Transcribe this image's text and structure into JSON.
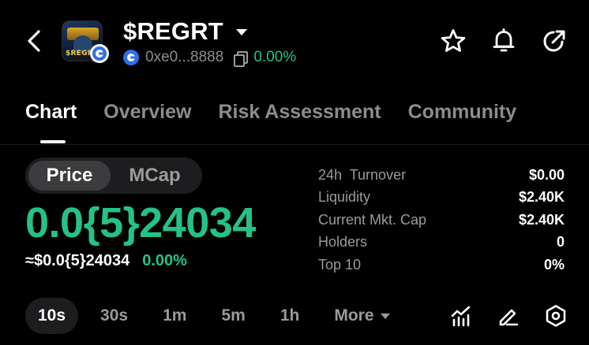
{
  "header": {
    "token_name": "$REGRT",
    "avatar_text": "$REGRT",
    "address": "0xe0...8888",
    "change": "0.00%"
  },
  "tabs": [
    {
      "label": "Chart",
      "active": true
    },
    {
      "label": "Overview",
      "active": false
    },
    {
      "label": "Risk Assessment",
      "active": false
    },
    {
      "label": "Community",
      "active": false
    }
  ],
  "toggle": {
    "price": "Price",
    "mcap": "MCap",
    "selected": "Price"
  },
  "price": {
    "big": "0.0{5}24034",
    "usd": "≈$0.0{5}24034",
    "change": "0.00%"
  },
  "stats": [
    {
      "label": "24h  Turnover",
      "value": "$0.00"
    },
    {
      "label": "Liquidity",
      "value": "$2.40K"
    },
    {
      "label": "Current Mkt. Cap",
      "value": "$2.40K"
    },
    {
      "label": "Holders",
      "value": "0"
    },
    {
      "label": "Top 10",
      "value": "0%"
    }
  ],
  "timeframes": {
    "items": [
      "10s",
      "30s",
      "1m",
      "5m",
      "1h"
    ],
    "selected": "10s",
    "more": "More"
  },
  "colors": {
    "positive": "#25c285",
    "background": "#000000",
    "muted": "#8c8c8c"
  },
  "icons": [
    "back-arrow-icon",
    "caret-down-icon",
    "chain-icon",
    "copy-icon",
    "star-icon",
    "bell-icon",
    "share-icon",
    "indicator-icon",
    "draw-icon",
    "settings-icon"
  ]
}
